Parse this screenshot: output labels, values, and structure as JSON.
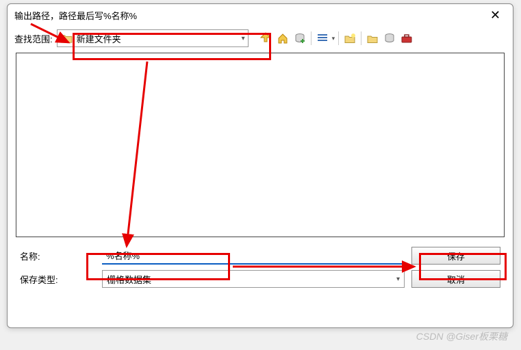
{
  "titlebar": {
    "title": "输出路径，路径最后写%名称%"
  },
  "lookin": {
    "label": "查找范围:",
    "folder_name": "新建文件夹"
  },
  "name_row": {
    "label": "名称:",
    "value": "%名称%"
  },
  "type_row": {
    "label": "保存类型:",
    "value": "栅格数据集"
  },
  "buttons": {
    "save": "保存",
    "cancel": "取消"
  },
  "watermark": "CSDN @Giser板栗糖"
}
